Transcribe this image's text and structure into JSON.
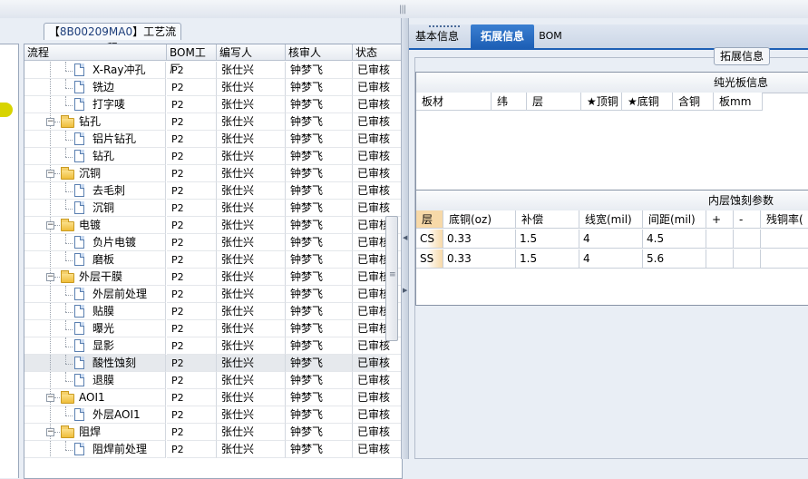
{
  "process_tab": {
    "id": "8B00209MA0",
    "title": "工艺流程"
  },
  "tree_grid": {
    "columns": [
      "流程",
      "BOM工厂",
      "编写人",
      "核审人",
      "状态"
    ],
    "rows": [
      {
        "name": "X-Ray冲孔",
        "type": "leaf",
        "level": 2,
        "bom": "P2",
        "writer": "张仕兴",
        "reviewer": "钟梦飞",
        "status": "已审核"
      },
      {
        "name": "铣边",
        "type": "leaf",
        "level": 2,
        "bom": "P2",
        "writer": "张仕兴",
        "reviewer": "钟梦飞",
        "status": "已审核"
      },
      {
        "name": "打字唛",
        "type": "leaf",
        "level": 2,
        "bom": "P2",
        "writer": "张仕兴",
        "reviewer": "钟梦飞",
        "status": "已审核"
      },
      {
        "name": "钻孔",
        "type": "folder",
        "level": 1,
        "bom": "P2",
        "writer": "张仕兴",
        "reviewer": "钟梦飞",
        "status": "已审核"
      },
      {
        "name": "铝片钻孔",
        "type": "leaf",
        "level": 2,
        "bom": "P2",
        "writer": "张仕兴",
        "reviewer": "钟梦飞",
        "status": "已审核"
      },
      {
        "name": "钻孔",
        "type": "leaf",
        "level": 2,
        "bom": "P2",
        "writer": "张仕兴",
        "reviewer": "钟梦飞",
        "status": "已审核"
      },
      {
        "name": "沉铜",
        "type": "folder",
        "level": 1,
        "bom": "P2",
        "writer": "张仕兴",
        "reviewer": "钟梦飞",
        "status": "已审核"
      },
      {
        "name": "去毛刺",
        "type": "leaf",
        "level": 2,
        "bom": "P2",
        "writer": "张仕兴",
        "reviewer": "钟梦飞",
        "status": "已审核"
      },
      {
        "name": "沉铜",
        "type": "leaf",
        "level": 2,
        "bom": "P2",
        "writer": "张仕兴",
        "reviewer": "钟梦飞",
        "status": "已审核"
      },
      {
        "name": "电镀",
        "type": "folder",
        "level": 1,
        "bom": "P2",
        "writer": "张仕兴",
        "reviewer": "钟梦飞",
        "status": "已审核"
      },
      {
        "name": "负片电镀",
        "type": "leaf",
        "level": 2,
        "bom": "P2",
        "writer": "张仕兴",
        "reviewer": "钟梦飞",
        "status": "已审核"
      },
      {
        "name": "磨板",
        "type": "leaf",
        "level": 2,
        "bom": "P2",
        "writer": "张仕兴",
        "reviewer": "钟梦飞",
        "status": "已审核"
      },
      {
        "name": "外层干膜",
        "type": "folder",
        "level": 1,
        "bom": "P2",
        "writer": "张仕兴",
        "reviewer": "钟梦飞",
        "status": "已审核"
      },
      {
        "name": "外层前处理",
        "type": "leaf",
        "level": 2,
        "bom": "P2",
        "writer": "张仕兴",
        "reviewer": "钟梦飞",
        "status": "已审核"
      },
      {
        "name": "贴膜",
        "type": "leaf",
        "level": 2,
        "bom": "P2",
        "writer": "张仕兴",
        "reviewer": "钟梦飞",
        "status": "已审核"
      },
      {
        "name": "曝光",
        "type": "leaf",
        "level": 2,
        "bom": "P2",
        "writer": "张仕兴",
        "reviewer": "钟梦飞",
        "status": "已审核"
      },
      {
        "name": "显影",
        "type": "leaf",
        "level": 2,
        "bom": "P2",
        "writer": "张仕兴",
        "reviewer": "钟梦飞",
        "status": "已审核"
      },
      {
        "name": "酸性蚀刻",
        "type": "leaf",
        "level": 2,
        "bom": "P2",
        "writer": "张仕兴",
        "reviewer": "钟梦飞",
        "status": "已审核",
        "selected": true
      },
      {
        "name": "退膜",
        "type": "leaf",
        "level": 2,
        "bom": "P2",
        "writer": "张仕兴",
        "reviewer": "钟梦飞",
        "status": "已审核"
      },
      {
        "name": "AOI1",
        "type": "folder",
        "level": 1,
        "bom": "P2",
        "writer": "张仕兴",
        "reviewer": "钟梦飞",
        "status": "已审核"
      },
      {
        "name": "外层AOI1",
        "type": "leaf",
        "level": 2,
        "bom": "P2",
        "writer": "张仕兴",
        "reviewer": "钟梦飞",
        "status": "已审核"
      },
      {
        "name": "阻焊",
        "type": "folder",
        "level": 1,
        "bom": "P2",
        "writer": "张仕兴",
        "reviewer": "钟梦飞",
        "status": "已审核"
      },
      {
        "name": "阻焊前处理",
        "type": "leaf",
        "level": 2,
        "bom": "P2",
        "writer": "张仕兴",
        "reviewer": "钟梦飞",
        "status": "已审核"
      }
    ]
  },
  "right_tabs": [
    {
      "label": "基本信息",
      "active": false
    },
    {
      "label": "拓展信息",
      "active": true
    },
    {
      "label": "BOM",
      "active": false
    }
  ],
  "extend_group_label": "拓展信息",
  "bare_board": {
    "title": "纯光板信息",
    "columns": [
      "板材",
      "纬",
      "层",
      "★顶铜",
      "★底铜",
      "含铜",
      "板mm"
    ]
  },
  "inner_etch": {
    "title": "内层蚀刻参数",
    "columns": [
      "层",
      "底铜(oz)",
      "补偿",
      "线宽(mil)",
      "间距(mil)",
      "+",
      "-",
      "残铜率("
    ],
    "rows": [
      [
        "CS",
        "0.33",
        "1.5",
        "4",
        "4.5",
        "",
        "",
        ""
      ],
      [
        "SS",
        "0.33",
        "1.5",
        "4",
        "5.6",
        "",
        "",
        ""
      ]
    ]
  },
  "colors": {
    "accent": "#1d5fb5",
    "selected_row": "#e6e9ed",
    "layer_cell": "#f7d9a8"
  }
}
